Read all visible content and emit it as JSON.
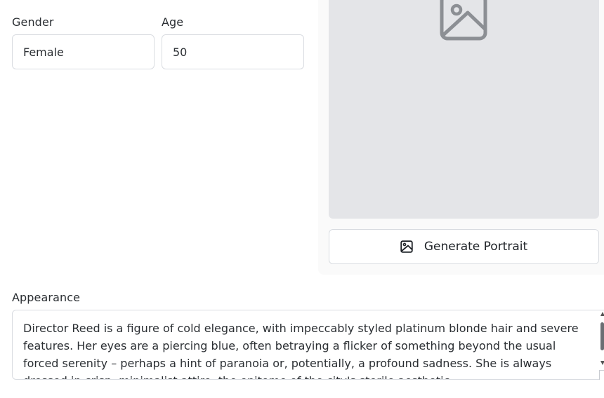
{
  "form": {
    "gender": {
      "label": "Gender",
      "value": "Female"
    },
    "age": {
      "label": "Age",
      "value": "50"
    },
    "appearance": {
      "label": "Appearance",
      "value": "Director Reed is a figure of cold elegance, with impeccably styled platinum blonde hair and severe features. Her eyes are a piercing blue, often betraying a flicker of something beyond the usual forced serenity – perhaps a hint of paranoia or, potentially, a profound sadness. She is always dressed in crisp, minimalist attire, the epitome of the city's sterile aesthetic."
    }
  },
  "portrait": {
    "placeholder_icon": "image-placeholder-icon",
    "button_label": "Generate Portrait",
    "button_icon": "image-icon"
  },
  "colors": {
    "placeholder_bg": "#e4e5e8",
    "panel_bg": "#fafafa",
    "border": "#d9dce1",
    "icon_gray": "#8c8f94"
  }
}
